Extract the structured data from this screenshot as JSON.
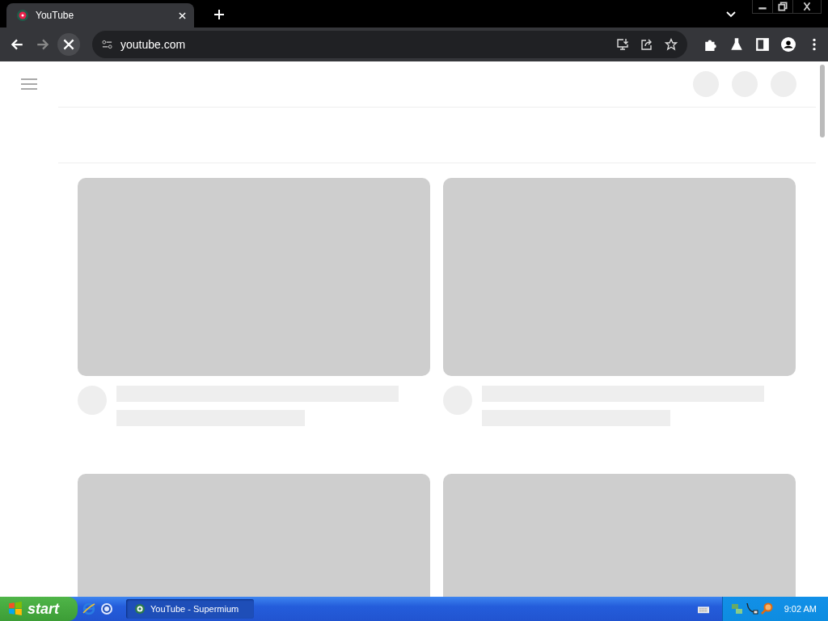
{
  "tabs": [
    {
      "title": "YouTube",
      "selected": true
    }
  ],
  "toolbar": {
    "loading": true,
    "url": "youtube.com"
  },
  "taskbar": {
    "start": "start",
    "tasks": [
      {
        "label": "YouTube - Supermium",
        "selected": true
      }
    ],
    "clock": "9:02 AM"
  }
}
